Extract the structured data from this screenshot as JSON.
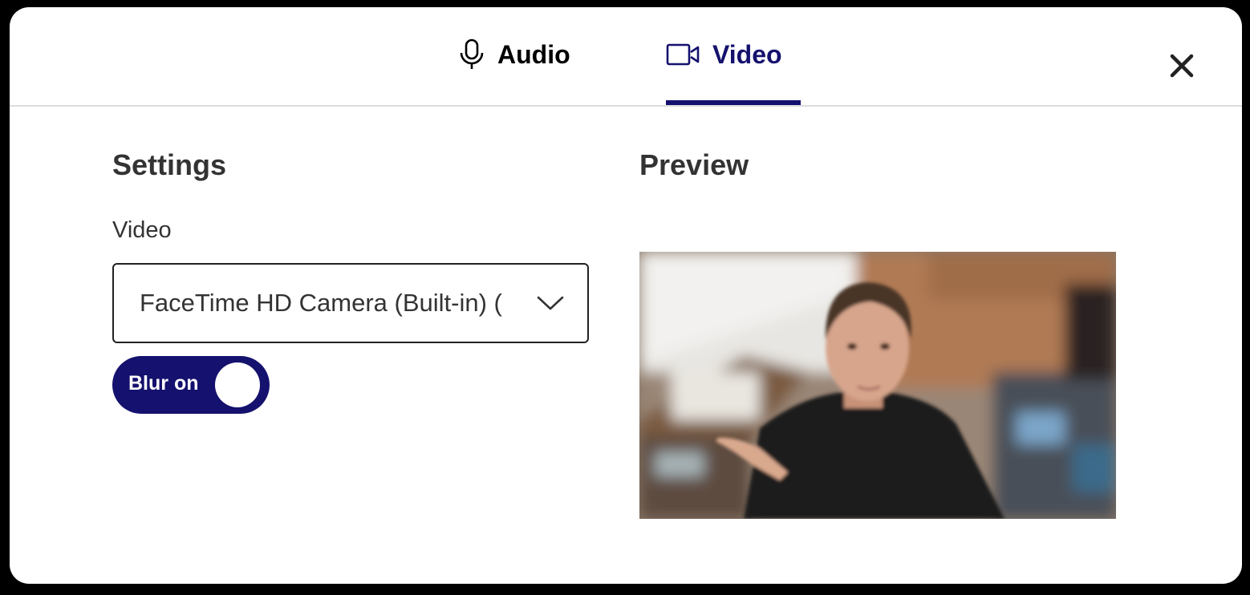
{
  "tabs": {
    "audio_label": "Audio",
    "video_label": "Video",
    "active": "Video"
  },
  "settings": {
    "heading": "Settings",
    "video_label": "Video",
    "camera_selected": "FaceTime HD Camera (Built-in) (",
    "blur_toggle_label": "Blur on",
    "blur_enabled": true
  },
  "preview": {
    "heading": "Preview"
  },
  "icons": {
    "audio": "microphone-icon",
    "video": "video-camera-icon",
    "close": "close-icon",
    "dropdown": "chevron-down-icon"
  },
  "colors": {
    "accent": "#15116e",
    "text": "#333333",
    "overlay": "#000000"
  }
}
